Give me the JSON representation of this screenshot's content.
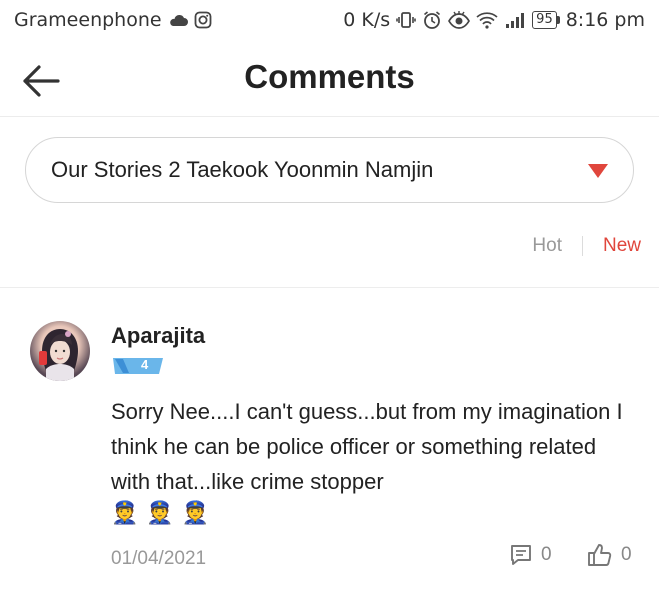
{
  "status_bar": {
    "carrier": "Grameenphone",
    "net_speed": "0 K/s",
    "battery": "95",
    "time": "8:16 pm",
    "icons": [
      "cloud-icon",
      "instagram-icon",
      "vibrate-icon",
      "alarm-icon",
      "eye-icon",
      "wifi-icon",
      "signal-icon",
      "battery-icon"
    ]
  },
  "header": {
    "title": "Comments",
    "back_icon": "arrow-left-icon"
  },
  "story_selector": {
    "selected": "Our Stories 2 Taekook Yoonmin Namjin",
    "accent": "#e0463c"
  },
  "sort_tabs": {
    "hot": "Hot",
    "new": "New",
    "active": "New"
  },
  "comment": {
    "author": "Aparajita",
    "level": "4",
    "text": "Sorry Nee....I can't guess...but from my imagination I think he can be police officer or something related with that...like crime stopper",
    "emojis": [
      "👮",
      "👮",
      "👮"
    ],
    "date": "01/04/2021",
    "reply_count": "0",
    "like_count": "0"
  }
}
